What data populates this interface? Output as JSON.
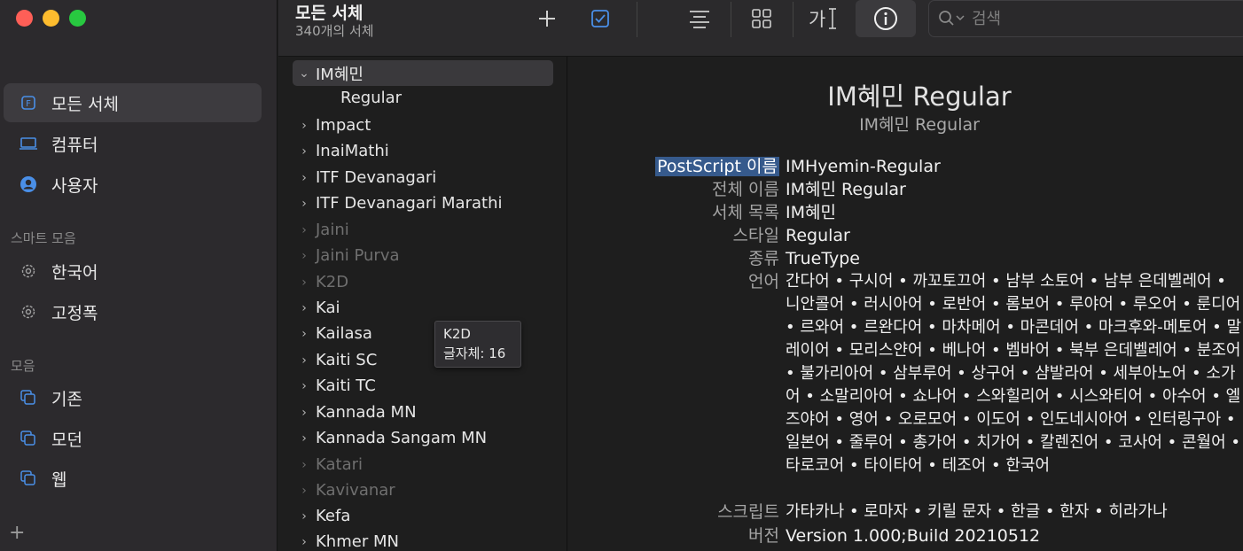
{
  "sidebar": {
    "items": [
      {
        "label": "모든 서체",
        "icon": "font-book-icon"
      },
      {
        "label": "컴퓨터",
        "icon": "laptop-icon"
      },
      {
        "label": "사용자",
        "icon": "user-icon"
      }
    ],
    "smart_section_label": "스마트 모음",
    "smart_items": [
      {
        "label": "한국어",
        "icon": "gear-icon"
      },
      {
        "label": "고정폭",
        "icon": "gear-icon"
      }
    ],
    "collection_section_label": "모음",
    "collection_items": [
      {
        "label": "기존",
        "icon": "collection-icon"
      },
      {
        "label": "모던",
        "icon": "collection-icon"
      },
      {
        "label": "웹",
        "icon": "collection-icon"
      }
    ],
    "add_label": "+"
  },
  "toolbar": {
    "title": "모든 서체",
    "subtitle": "340개의 서체",
    "search_placeholder": "검색",
    "icons": [
      "plus-icon",
      "checkbox-icon",
      "text-align-icon",
      "grid-icon",
      "text-sample-icon",
      "info-icon",
      "search-icon"
    ]
  },
  "fontlist": {
    "rows": [
      {
        "label": "IM혜민",
        "expanded": true,
        "dim": false
      },
      {
        "label": "Impact",
        "dim": false
      },
      {
        "label": "InaiMathi",
        "dim": false
      },
      {
        "label": "ITF Devanagari",
        "dim": false
      },
      {
        "label": "ITF Devanagari Marathi",
        "dim": false
      },
      {
        "label": "Jaini",
        "dim": true
      },
      {
        "label": "Jaini Purva",
        "dim": true
      },
      {
        "label": "K2D",
        "dim": true
      },
      {
        "label": "Kai",
        "dim": false
      },
      {
        "label": "Kailasa",
        "dim": false
      },
      {
        "label": "Kaiti SC",
        "dim": false
      },
      {
        "label": "Kaiti TC",
        "dim": false
      },
      {
        "label": "Kannada MN",
        "dim": false
      },
      {
        "label": "Kannada Sangam MN",
        "dim": false
      },
      {
        "label": "Katari",
        "dim": true
      },
      {
        "label": "Kavivanar",
        "dim": true
      },
      {
        "label": "Kefa",
        "dim": false
      },
      {
        "label": "Khmer MN",
        "dim": false
      }
    ],
    "sub_row": "Regular",
    "tooltip": {
      "line1": "K2D",
      "line2": "글자체: 16"
    }
  },
  "detail": {
    "title": "IM혜민 Regular",
    "subtitle": "IM혜민 Regular",
    "properties": [
      {
        "label": "PostScript 이름",
        "value": "IMHyemin-Regular",
        "highlight": true
      },
      {
        "label": "전체 이름",
        "value": "IM혜민 Regular"
      },
      {
        "label": "서체 목록",
        "value": "IM혜민"
      },
      {
        "label": "스타일",
        "value": "Regular"
      },
      {
        "label": "종류",
        "value": "TrueType"
      },
      {
        "label": "언어",
        "value": "간다어 • 구시어 • 까꼬토끄어 • 남부 소토어 • 남부 은데벨레어 • 니안콜어 • 러시아어 • 로반어 • 롬보어 • 루야어 • 루오어 • 룬디어 • 르와어 • 르완다어 • 마차메어 • 마콘데어 • 마크후와-메토어 • 말레이어 • 모리스얀어 • 베나어 • 벰바어 • 북부 은데벨레어 • 분조어 • 불가리아어 • 삼부루어 • 상구어 • 샴발라어 • 세부아노어 • 소가어 • 소말리아어 • 쇼나어 • 스와힐리어 • 시스와티어 • 아수어 • 엘즈야어 • 영어 • 오로모어 • 이도어 • 인도네시아어 • 인터링구아 • 일본어 • 줄루어 • 총가어 • 치가어 • 칼렌진어 • 코사어 • 콘월어 • 타로코어 • 타이타어 • 테조어 • 한국어"
      },
      {
        "label": "스크립트",
        "value": "가타카나 • 로마자 • 키릴 문자 • 한글 • 한자 • 히라가나"
      },
      {
        "label": "버전",
        "value": "Version 1.000;Build 20210512"
      }
    ]
  },
  "colors": {
    "accent": "#4a8fe7",
    "selection_highlight": "#365a8c",
    "sidebar_bg": "#2c2a2d",
    "content_bg": "#1e1e1e"
  }
}
